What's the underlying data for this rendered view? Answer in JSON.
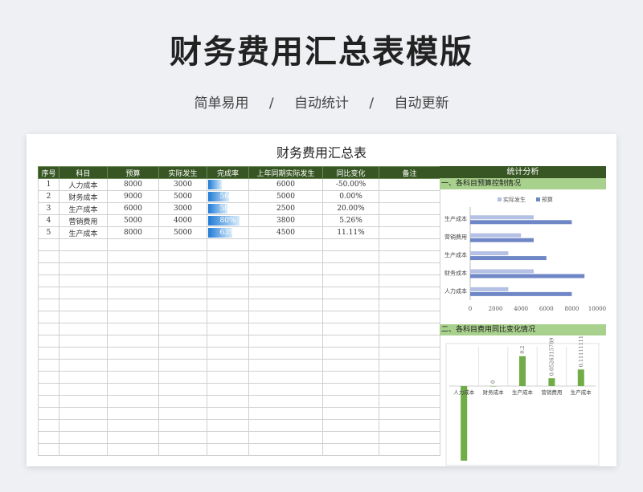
{
  "header": {
    "title": "财务费用汇总表模版",
    "taglines": [
      "简单易用",
      "/",
      "自动统计",
      "/",
      "自动更新"
    ]
  },
  "sheet": {
    "title": "财务费用汇总表",
    "columns": [
      "序号",
      "科目",
      "预算",
      "实际发生",
      "完成率",
      "上年同期实际发生",
      "同比变化",
      "备注"
    ],
    "rows": [
      {
        "no": "1",
        "item": "人力成本",
        "budget": "8000",
        "actual": "3000",
        "rate": "38%",
        "rate_value": 0.375,
        "last_year": "6000",
        "yoy": "-50.00%",
        "note": ""
      },
      {
        "no": "2",
        "item": "财务成本",
        "budget": "9000",
        "actual": "5000",
        "rate": "56%",
        "rate_value": 0.556,
        "last_year": "5000",
        "yoy": "0.00%",
        "note": ""
      },
      {
        "no": "3",
        "item": "生产成本",
        "budget": "6000",
        "actual": "3000",
        "rate": "50%",
        "rate_value": 0.5,
        "last_year": "2500",
        "yoy": "20.00%",
        "note": ""
      },
      {
        "no": "4",
        "item": "营销费用",
        "budget": "5000",
        "actual": "4000",
        "rate": "80%",
        "rate_value": 0.8,
        "last_year": "3800",
        "yoy": "5.26%",
        "note": ""
      },
      {
        "no": "5",
        "item": "生产成本",
        "budget": "8000",
        "actual": "5000",
        "rate": "63%",
        "rate_value": 0.625,
        "last_year": "4500",
        "yoy": "11.11%",
        "note": ""
      }
    ],
    "empty_rows": 18
  },
  "panel": {
    "title": "统计分析",
    "section1": "一、各科目预算控制情况",
    "section2": "二、各科目费用同比变化情况"
  },
  "chart_data": [
    {
      "type": "bar",
      "orientation": "horizontal",
      "categories": [
        "人力成本",
        "财务成本",
        "生产成本",
        "营销费用",
        "生产成本"
      ],
      "series": [
        {
          "name": "实际发生",
          "values": [
            3000,
            5000,
            3000,
            4000,
            5000
          ],
          "color": "#b4c0e4"
        },
        {
          "name": "预算",
          "values": [
            8000,
            9000,
            6000,
            5000,
            8000
          ],
          "color": "#6f87c6"
        }
      ],
      "xlim": [
        0,
        10000
      ],
      "xticks": [
        "0",
        "2000",
        "4000",
        "6000",
        "8000",
        "10000"
      ],
      "legend": "top"
    },
    {
      "type": "bar",
      "categories": [
        "人力成本",
        "财务成本",
        "生产成本",
        "营销费用",
        "生产成本"
      ],
      "values": [
        -0.5,
        0,
        0.2,
        0.0526315789,
        0.1111111111
      ],
      "data_labels": [
        "",
        "0",
        "0.2",
        "0.0526315789",
        "0.11111111"
      ],
      "color": "#70ad47"
    }
  ]
}
